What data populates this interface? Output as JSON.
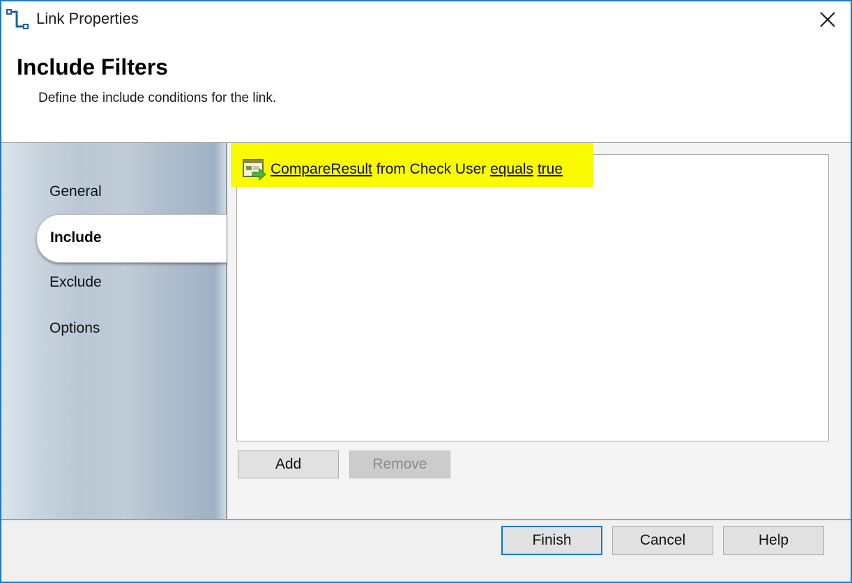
{
  "window": {
    "title": "Link Properties",
    "close_label": "close"
  },
  "header": {
    "title": "Include Filters",
    "subtitle": "Define the include conditions for the link."
  },
  "sidebar": {
    "items": [
      {
        "label": "General",
        "selected": false
      },
      {
        "label": "Include",
        "selected": true
      },
      {
        "label": "Exclude",
        "selected": false
      },
      {
        "label": "Options",
        "selected": false
      }
    ]
  },
  "filters": [
    {
      "icon": "filter-condition-icon",
      "field": "CompareResult",
      "from_text": " from Check User ",
      "operator": "equals",
      "value": "true",
      "highlighted": true
    }
  ],
  "list_buttons": {
    "add": "Add",
    "remove": "Remove"
  },
  "footer": {
    "finish": "Finish",
    "cancel": "Cancel",
    "help": "Help"
  },
  "colors": {
    "accent": "#0078d7",
    "highlight": "#fbfb00",
    "window_border": "#1979ca"
  }
}
